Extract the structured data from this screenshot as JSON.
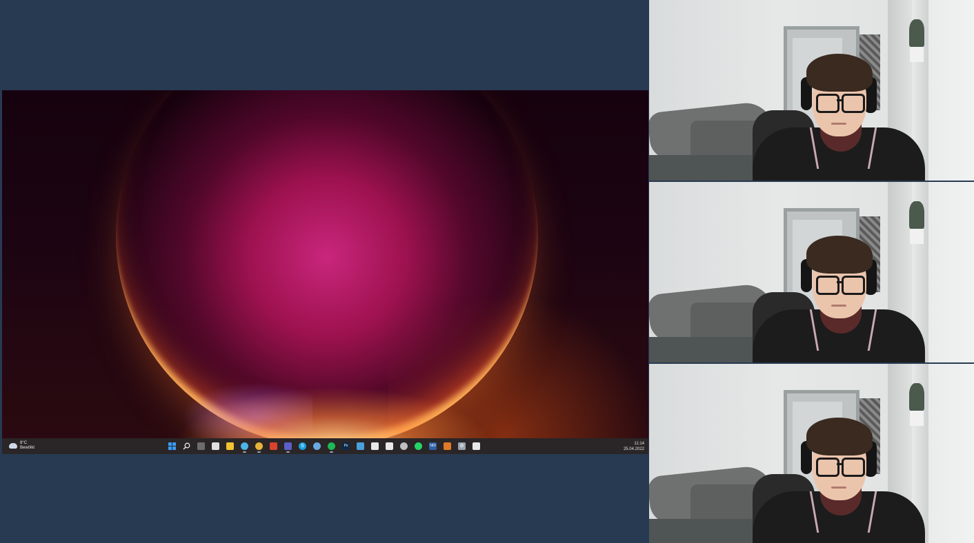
{
  "taskbar": {
    "weather": {
      "temp": "8°C",
      "condition": "Bewölkt",
      "icon": "cloud-icon"
    },
    "clock": {
      "time": "11:14",
      "date": "25.04.2022"
    },
    "apps": [
      {
        "name": "start-icon",
        "color": "#2f8ff0",
        "glyph": "",
        "active": false
      },
      {
        "name": "search-icon",
        "color": "#2a2527",
        "glyph": "⌕",
        "active": false
      },
      {
        "name": "task-view-icon",
        "color": "#6d6d6d",
        "glyph": "",
        "active": false
      },
      {
        "name": "widgets-icon",
        "color": "#e0e0e0",
        "glyph": "",
        "active": false
      },
      {
        "name": "file-explorer-icon",
        "color": "#f2c231",
        "glyph": "",
        "active": false
      },
      {
        "name": "edge-icon",
        "color": "#4db4e8",
        "glyph": "",
        "active": true
      },
      {
        "name": "chrome-icon",
        "color": "#e4b53a",
        "glyph": "",
        "active": true
      },
      {
        "name": "toolbox-icon",
        "color": "#d9422f",
        "glyph": "",
        "active": false
      },
      {
        "name": "teams-icon",
        "color": "#5b5fc7",
        "glyph": "",
        "active": true
      },
      {
        "name": "skype-icon",
        "color": "#1aa0e0",
        "glyph": "S",
        "active": false
      },
      {
        "name": "chat-icon",
        "color": "#6aa8e0",
        "glyph": "",
        "active": false
      },
      {
        "name": "spotify-icon",
        "color": "#1db954",
        "glyph": "",
        "active": true
      },
      {
        "name": "photoshop-icon",
        "color": "#0c2a4a",
        "glyph": "Ps",
        "active": false
      },
      {
        "name": "notepad-icon",
        "color": "#4aa0d8",
        "glyph": "",
        "active": false
      },
      {
        "name": "recorder-icon",
        "color": "#e8e8e8",
        "glyph": "",
        "active": false
      },
      {
        "name": "app-icon",
        "color": "#e8e8e8",
        "glyph": "",
        "active": false
      },
      {
        "name": "clock-app-icon",
        "color": "#bfbfbf",
        "glyph": "",
        "active": false
      },
      {
        "name": "whatsapp-icon",
        "color": "#25d366",
        "glyph": "",
        "active": false
      },
      {
        "name": "ndi-icon",
        "color": "#2f5fa8",
        "glyph": "NDI",
        "active": false
      },
      {
        "name": "office-icon",
        "color": "#e07a28",
        "glyph": "",
        "active": false
      },
      {
        "name": "settings-icon",
        "color": "#9aa3b0",
        "glyph": "⚙",
        "active": false
      },
      {
        "name": "snipping-tool-icon",
        "color": "#e8e8e8",
        "glyph": "",
        "active": false
      }
    ]
  }
}
